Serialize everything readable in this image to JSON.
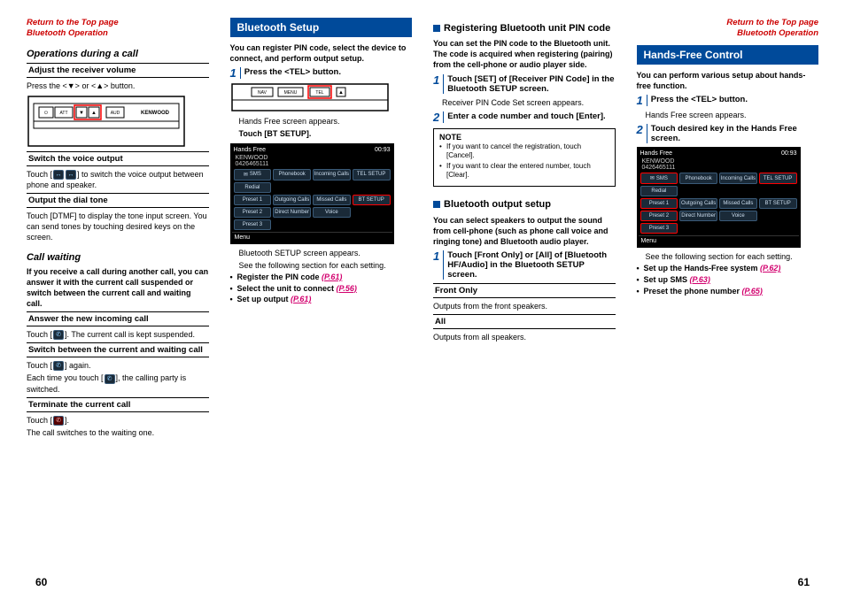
{
  "top_links": {
    "return": "Return to the Top page",
    "section": "Bluetooth Operation"
  },
  "col1": {
    "ops_call": "Operations during a call",
    "adjust_vol": "Adjust the receiver volume",
    "press_vol": "Press the <▼> or <▲> button.",
    "switch_voice": "Switch the voice output",
    "switch_voice_body": "Touch [      ] to switch the voice output between phone and speaker.",
    "output_dial": "Output the dial tone",
    "output_dial_body": "Touch [DTMF] to display the tone input screen. You can send tones by touching desired keys on the screen.",
    "call_wait": "Call waiting",
    "call_wait_body": "If you receive a call during another call, you can answer it with the current call suspended or switch between the current call and waiting call.",
    "answer_new": "Answer the new incoming call",
    "answer_new_body": "Touch [    ]. The current call is kept suspended.",
    "switch_between": "Switch between the current and waiting call",
    "switch_body1": "Touch [    ] again.",
    "switch_body2": "Each time you touch [    ], the calling party is switched.",
    "terminate": "Terminate the current call",
    "terminate_body": "Touch [    ].",
    "terminate_body2": "The call switches to the waiting one."
  },
  "col2": {
    "head": "Bluetooth Setup",
    "intro": "You can register PIN code, select the device to connect, and perform output setup.",
    "step1": "Press the <TEL> button.",
    "screen_appears": "Hands Free screen appears.",
    "touch_bt": "Touch [BT SETUP].",
    "setup_appears": "Bluetooth SETUP screen appears.",
    "see_following": "See the following section for each setting.",
    "b1a": "Register the PIN code ",
    "b1b": "(P.61)",
    "b2a": "Select the unit to connect ",
    "b2b": "(P.56)",
    "b3a": "Set up output ",
    "b3b": "(P.61)"
  },
  "col3": {
    "head_reg": "Registering Bluetooth unit PIN code",
    "reg_body": "You can set the PIN code to the Bluetooth unit. The code is acquired when registering (pairing) from the cell-phone or audio player side.",
    "step1": "Touch [SET] of [Receiver PIN Code] in the Bluetooth SETUP screen.",
    "step1_sub": "Receiver PIN Code Set screen appears.",
    "step2": "Enter a code number and touch [Enter].",
    "note": "NOTE",
    "note1": "If you want to cancel the registration, touch [Cancel].",
    "note2": "If you want to clear the entered number, touch [Clear].",
    "head_out": "Bluetooth output setup",
    "out_body": "You can select speakers to output the sound from cell-phone (such as phone call voice and ringing tone) and Bluetooth audio player.",
    "out_step1": "Touch [Front Only] or [All] of [Bluetooth HF/Audio] in the Bluetooth SETUP screen.",
    "front_only": "Front Only",
    "front_only_body": "Outputs from the front speakers.",
    "all": "All",
    "all_body": "Outputs from all speakers."
  },
  "col4": {
    "head": "Hands-Free Control",
    "intro": "You can perform various setup about hands-free function.",
    "step1": "Press the <TEL> button.",
    "step1_sub": "Hands Free screen appears.",
    "step2": "Touch desired key in the Hands Free screen.",
    "see_following": "See the following section for each setting.",
    "b1a": "Set up the Hands-Free system ",
    "b1b": "(P.62)",
    "b2a": "Set up SMS ",
    "b2b": "(P.63)",
    "b3a": "Preset the phone number ",
    "b3b": "(P.65)"
  },
  "screens": {
    "hf_title": "Hands Free",
    "time": "00:93",
    "device": "KENWOOD",
    "number": "0426465111",
    "sms": "SMS",
    "phonebook": "Phonebook",
    "incoming": "Incoming Calls",
    "telsetup": "TEL SETUP",
    "redial": "Redial",
    "preset1": "Preset 1",
    "outgoing": "Outgoing Calls",
    "missed": "Missed Calls",
    "btsetup": "BT SETUP",
    "preset2": "Preset 2",
    "direct": "Direct Number",
    "voice": "Voice",
    "preset3": "Preset 3",
    "menu": "Menu"
  },
  "panel": {
    "att": "ATT",
    "aud": "AUD",
    "kenwood": "KENWOOD",
    "nav": "NAV",
    "menu": "MENU",
    "tel": "TEL"
  },
  "pages": {
    "left": "60",
    "right": "61"
  }
}
